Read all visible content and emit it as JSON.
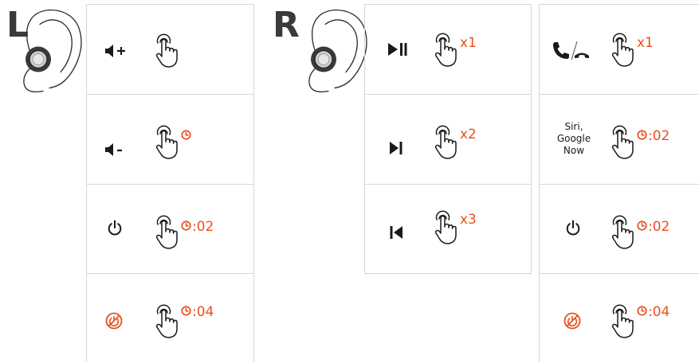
{
  "left_label": "L",
  "right_label": "R",
  "colors": {
    "accent": "#e8501e",
    "icon": "#1a1a1a",
    "grid": "#d6d6d6"
  },
  "left_panel": [
    {
      "icon": "volume-up-icon"
    },
    {
      "icon": "volume-down-icon",
      "badge_clock": true
    },
    {
      "icon": "power-icon",
      "badge_clock": true,
      "badge_text": ":02"
    },
    {
      "icon": "power-off-disabled-icon",
      "badge_clock": true,
      "badge_text": ":04"
    }
  ],
  "right_media_panel": [
    {
      "icon": "play-pause-icon",
      "badge_text": "x1"
    },
    {
      "icon": "next-track-icon",
      "badge_text": "x2"
    },
    {
      "icon": "previous-track-icon",
      "badge_text": "x3"
    }
  ],
  "right_call_panel": [
    {
      "icon": "answer-end-call-icon",
      "badge_text": "x1"
    },
    {
      "label_lines": [
        "Siri,",
        "Google",
        "Now"
      ],
      "badge_clock": true,
      "badge_text": ":02"
    },
    {
      "icon": "power-icon",
      "badge_clock": true,
      "badge_text": ":02"
    },
    {
      "icon": "power-off-disabled-icon",
      "badge_clock": true,
      "badge_text": ":04"
    }
  ]
}
